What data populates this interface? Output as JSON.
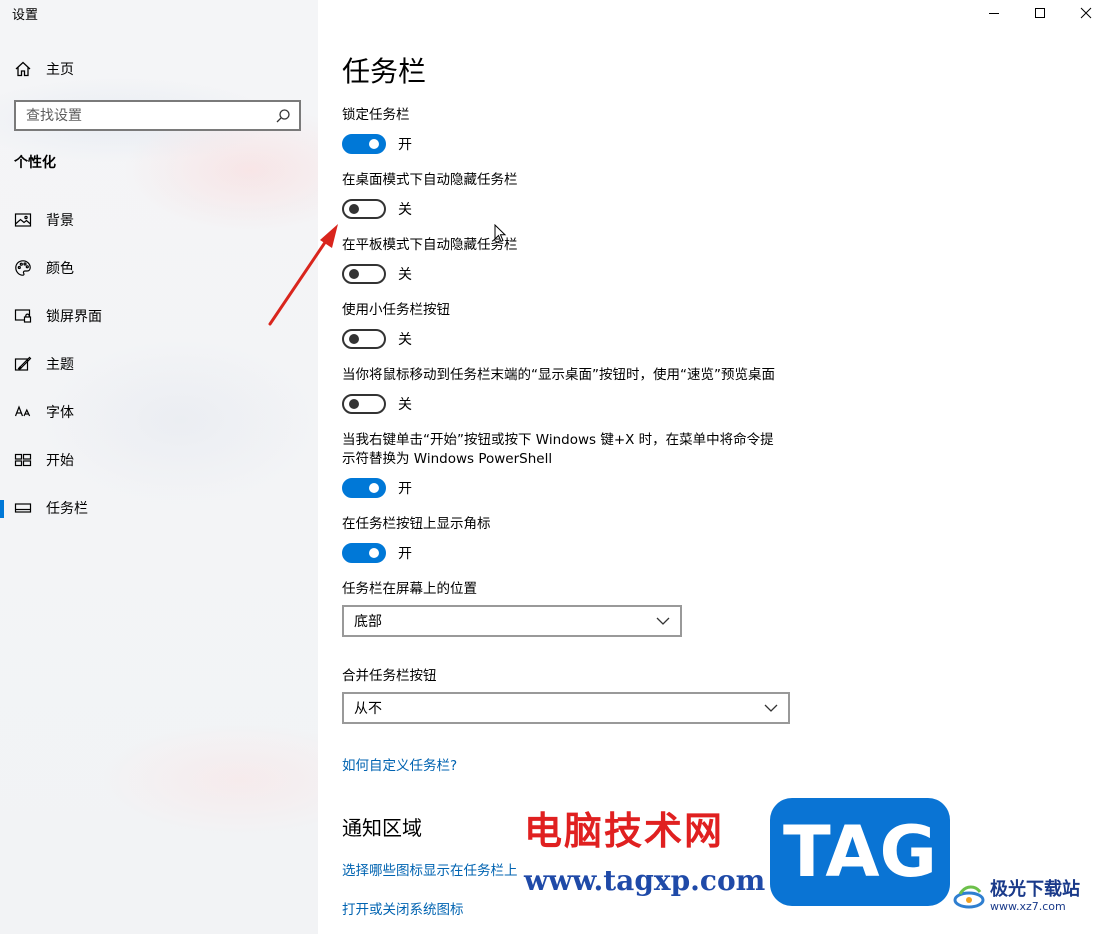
{
  "app": {
    "title": "设置"
  },
  "sidebar": {
    "home_label": "主页",
    "search_placeholder": "查找设置",
    "section_label": "个性化",
    "items": [
      {
        "label": "背景",
        "icon": "picture-icon"
      },
      {
        "label": "颜色",
        "icon": "palette-icon"
      },
      {
        "label": "锁屏界面",
        "icon": "lock-screen-icon"
      },
      {
        "label": "主题",
        "icon": "theme-brush-icon"
      },
      {
        "label": "字体",
        "icon": "font-icon"
      },
      {
        "label": "开始",
        "icon": "start-icon"
      },
      {
        "label": "任务栏",
        "icon": "taskbar-icon",
        "active": true
      }
    ]
  },
  "main": {
    "title": "任务栏",
    "settings": [
      {
        "label": "锁定任务栏",
        "state": "开",
        "on": true
      },
      {
        "label": "在桌面模式下自动隐藏任务栏",
        "state": "关",
        "on": false
      },
      {
        "label": "在平板模式下自动隐藏任务栏",
        "state": "关",
        "on": false
      },
      {
        "label": "使用小任务栏按钮",
        "state": "关",
        "on": false
      },
      {
        "label": "当你将鼠标移动到任务栏末端的“显示桌面”按钮时，使用“速览”预览桌面",
        "state": "关",
        "on": false
      },
      {
        "label": "当我右键单击“开始”按钮或按下 Windows 键+X 时，在菜单中将命令提示符替换为 Windows PowerShell",
        "state": "开",
        "on": true
      },
      {
        "label": "在任务栏按钮上显示角标",
        "state": "开",
        "on": true
      }
    ],
    "position": {
      "label": "任务栏在屏幕上的位置",
      "value": "底部"
    },
    "combine": {
      "label": "合并任务栏按钮",
      "value": "从不"
    },
    "help_link": "如何自定义任务栏?",
    "notification_title": "通知区域",
    "notification_links": [
      "选择哪些图标显示在任务栏上",
      "打开或关闭系统图标"
    ]
  },
  "watermark": {
    "title": "电脑技术网",
    "url": "www.tagxp.com",
    "tag": "TAG",
    "site_name": "极光下载站",
    "site_url": "www.xz7.com"
  },
  "colors": {
    "accent": "#0078d7",
    "link": "#0063b1",
    "watermark_red": "#e02020",
    "tag_blue": "#0a74d4"
  }
}
